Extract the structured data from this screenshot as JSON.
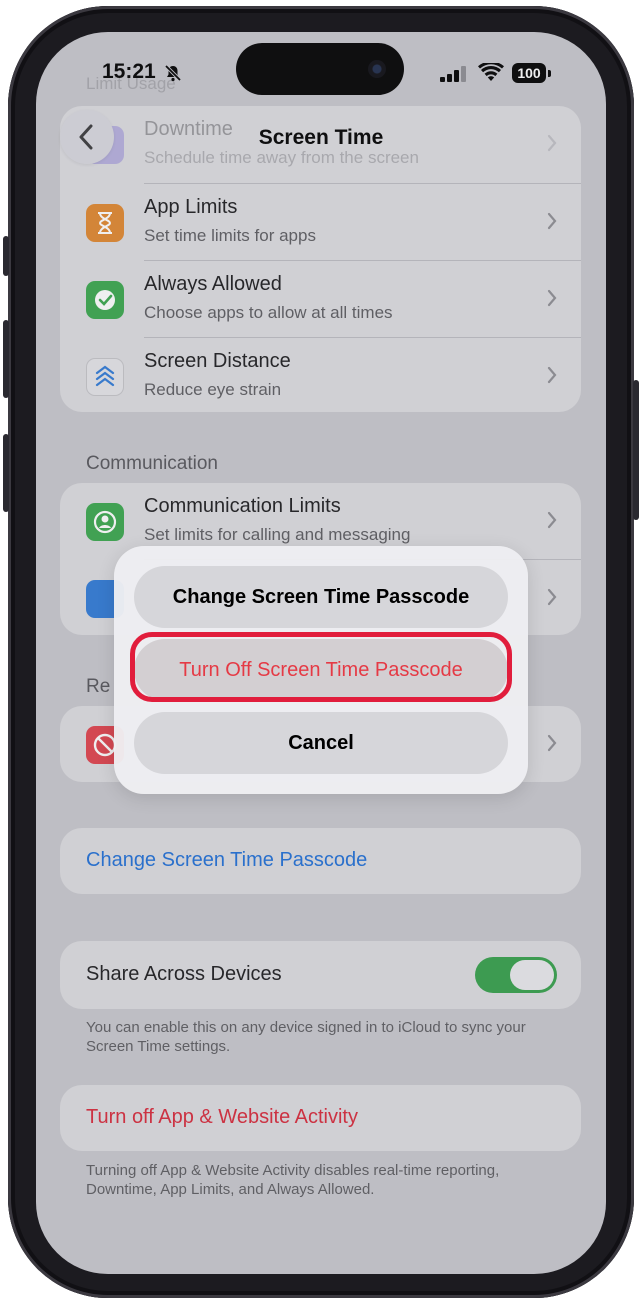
{
  "status_bar": {
    "time": "15:21",
    "battery": "100"
  },
  "nav": {
    "title": "Screen Time"
  },
  "faded_header": "Limit Usage",
  "limit_rows": [
    {
      "title": "Downtime",
      "subtitle": "Schedule time away from the screen"
    },
    {
      "title": "App Limits",
      "subtitle": "Set time limits for apps"
    },
    {
      "title": "Always Allowed",
      "subtitle": "Choose apps to allow at all times"
    },
    {
      "title": "Screen Distance",
      "subtitle": "Reduce eye strain"
    }
  ],
  "communication": {
    "header": "Communication",
    "rows": [
      {
        "title": "Communication Limits",
        "subtitle": "Set limits for calling and messaging"
      }
    ]
  },
  "restrictions": {
    "header_partial": "Re"
  },
  "passcode_link": "Change Screen Time Passcode",
  "share": {
    "label": "Share Across Devices",
    "on": true,
    "footer": "You can enable this on any device signed in to iCloud to sync your Screen Time settings."
  },
  "turn_off_activity": {
    "label": "Turn off App & Website Activity",
    "footer": "Turning off App & Website Activity disables real-time reporting, Downtime, App Limits, and Always Allowed."
  },
  "action_sheet": {
    "change_label": "Change Screen Time Passcode",
    "turn_off_label": "Turn Off Screen Time Passcode",
    "cancel_label": "Cancel"
  },
  "colors": {
    "link_blue": "#1f6fd6",
    "destructive_red": "#e53a45",
    "highlight": "#e11d3c",
    "toggle_green": "#35a04a"
  }
}
